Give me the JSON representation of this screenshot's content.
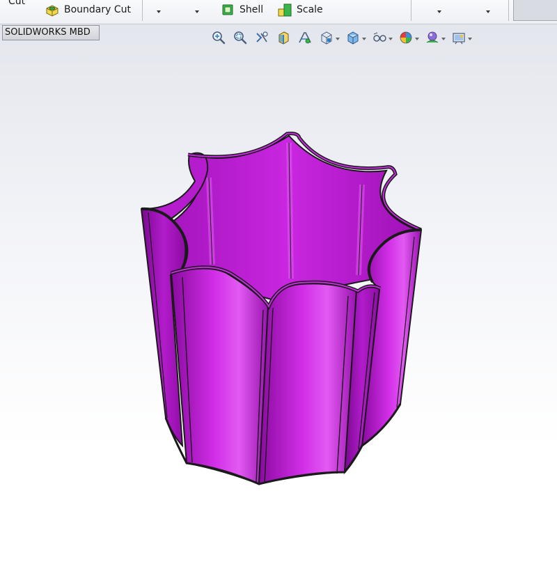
{
  "ribbon": {
    "cut_label": "Cut",
    "boundary_cut_label": "Boundary Cut",
    "shell_label": "Shell",
    "scale_label": "Scale"
  },
  "tabs": {
    "active_label": "SOLIDWORKS MBD"
  },
  "heads_up_toolbar": {
    "icons": [
      "zoom-to-fit-icon",
      "zoom-to-area-icon",
      "previous-view-icon",
      "section-view-icon",
      "dynamic-annotation-icon",
      "view-orientation-icon",
      "display-style-icon",
      "hide-show-items-icon",
      "edit-appearance-icon",
      "apply-scene-icon",
      "view-settings-icon"
    ]
  },
  "model": {
    "color": "#cc1ee0",
    "edge_color": "#1a1a1a",
    "description_hidden": ""
  }
}
